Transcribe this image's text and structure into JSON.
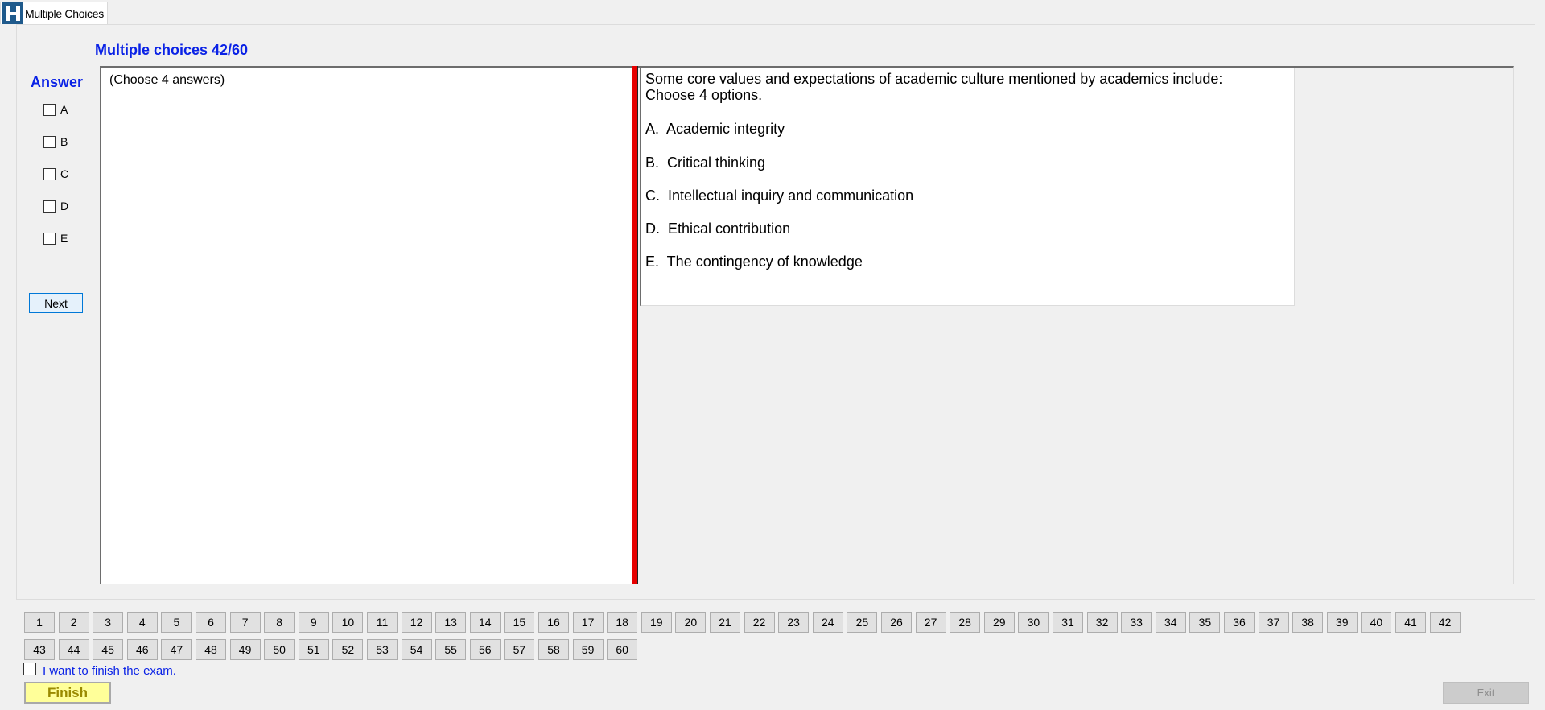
{
  "tab": {
    "title": "Multiple Choices",
    "logo_icon": "app-logo-icon"
  },
  "header": {
    "title": "Multiple choices 42/60"
  },
  "answer": {
    "title": "Answer",
    "options": [
      "A",
      "B",
      "C",
      "D",
      "E"
    ],
    "next_label": "Next",
    "hint": "(Choose 4 answers)"
  },
  "question": {
    "line1": "Some core values and expectations of academic culture mentioned by academics include:",
    "line2": "Choose 4 options.",
    "options": [
      "A.  Academic integrity",
      "B.  Critical thinking",
      "C.  Intellectual inquiry and communication",
      "D.  Ethical contribution",
      "E.  The contingency of knowledge"
    ]
  },
  "nav": {
    "numbers": [
      "1",
      "2",
      "3",
      "4",
      "5",
      "6",
      "7",
      "8",
      "9",
      "10",
      "11",
      "12",
      "13",
      "14",
      "15",
      "16",
      "17",
      "18",
      "19",
      "20",
      "21",
      "22",
      "23",
      "24",
      "25",
      "26",
      "27",
      "28",
      "29",
      "30",
      "31",
      "32",
      "33",
      "34",
      "35",
      "36",
      "37",
      "38",
      "39",
      "40",
      "41",
      "42",
      "43",
      "44",
      "45",
      "46",
      "47",
      "48",
      "49",
      "50",
      "51",
      "52",
      "53",
      "54",
      "55",
      "56",
      "57",
      "58",
      "59",
      "60"
    ]
  },
  "footer": {
    "finish_check_label": "I want to finish the exam.",
    "finish_label": "Finish",
    "exit_label": "Exit"
  },
  "colors": {
    "accent_blue": "#0a22e6",
    "splitter_red": "#e60000",
    "finish_yellow": "#ffff99"
  }
}
